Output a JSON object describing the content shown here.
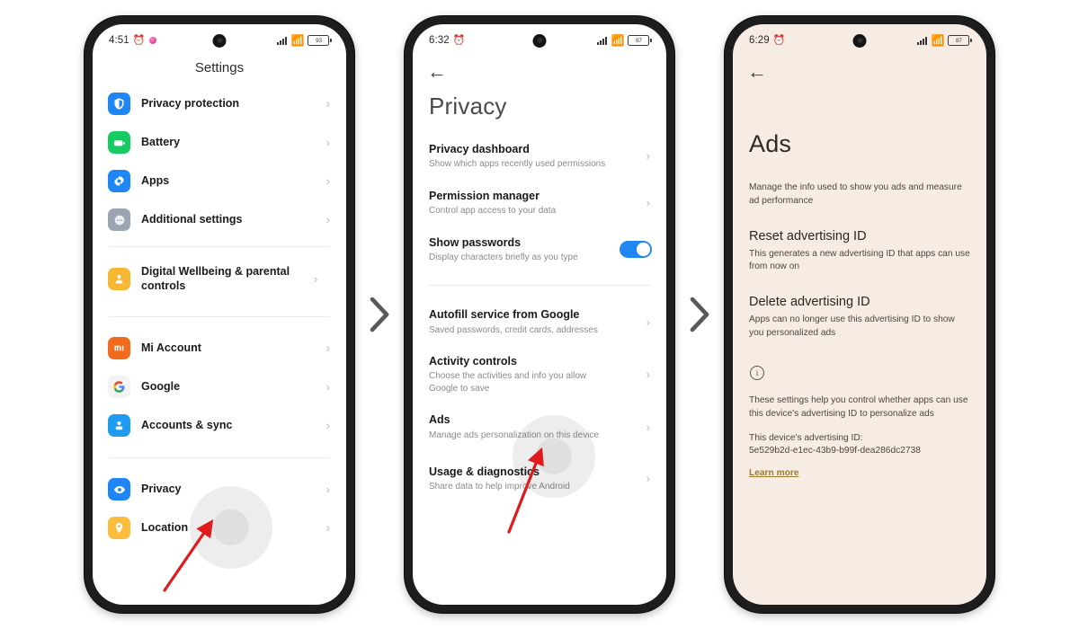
{
  "flow": {
    "separator_icon": "chevron-right-icon",
    "separator_color": "#595959"
  },
  "phone1": {
    "status_bar": {
      "time": "4:51",
      "alarm_icon": "alarm-clock-icon",
      "notification_icon": "notification-dot-icon",
      "signal_icon": "cellular-signal-icon",
      "wifi_icon": "wifi-icon",
      "battery_level": "93"
    },
    "header_title": "Settings",
    "groups": [
      {
        "items": [
          {
            "label": "Privacy protection",
            "icon": "shield-privacy-icon",
            "icon_bg": "#1f86f5",
            "chevron": "›"
          },
          {
            "label": "Battery",
            "icon": "battery-icon",
            "icon_bg": "#16cc62",
            "chevron": "›"
          },
          {
            "label": "Apps",
            "icon": "apps-gear-icon",
            "icon_bg": "#1f86f5",
            "chevron": "›"
          },
          {
            "label": "Additional settings",
            "icon": "more-dots-icon",
            "icon_bg": "#9aa5b1",
            "chevron": "›"
          }
        ]
      },
      {
        "items": [
          {
            "label": "Digital Wellbeing & parental controls",
            "icon": "person-wellbeing-icon",
            "icon_bg": "#f7b733",
            "chevron": "›"
          }
        ]
      },
      {
        "items": [
          {
            "label": "Mi Account",
            "icon": "mi-logo-icon",
            "icon_bg": "#f26a1b",
            "chevron": "›"
          },
          {
            "label": "Google",
            "icon": "google-g-icon",
            "icon_bg": "#f3f3f3",
            "chevron": "›"
          },
          {
            "label": "Accounts & sync",
            "icon": "person-account-icon",
            "icon_bg": "#1f9cf0",
            "chevron": "›"
          }
        ]
      },
      {
        "items": [
          {
            "label": "Privacy",
            "icon": "eye-privacy-icon",
            "icon_bg": "#1f86f5",
            "chevron": "›"
          },
          {
            "label": "Location",
            "icon": "location-pin-icon",
            "icon_bg": "#fbbd3b",
            "chevron": "›"
          }
        ]
      }
    ],
    "tap_target_label": "Privacy",
    "annotation_arrow_color": "#e01b1b"
  },
  "phone2": {
    "status_bar": {
      "time": "6:32",
      "alarm_icon": "alarm-clock-icon",
      "signal_icon": "cellular-signal-icon",
      "wifi_icon": "wifi-icon",
      "battery_level": "87"
    },
    "back_icon": "back-arrow-icon",
    "title": "Privacy",
    "groups": [
      {
        "items": [
          {
            "title": "Privacy dashboard",
            "subtitle": "Show which apps recently used permissions",
            "control": "chevron",
            "chevron": "›"
          },
          {
            "title": "Permission manager",
            "subtitle": "Control app access to your data",
            "control": "chevron",
            "chevron": "›"
          },
          {
            "title": "Show passwords",
            "subtitle": "Display characters briefly as you type",
            "control": "toggle",
            "toggle_on": true
          }
        ]
      },
      {
        "items": [
          {
            "title": "Autofill service from Google",
            "subtitle": "Saved passwords, credit cards, addresses",
            "control": "chevron",
            "chevron": "›"
          },
          {
            "title": "Activity controls",
            "subtitle": "Choose the activities and info you allow Google to save",
            "control": "chevron",
            "chevron": "›"
          },
          {
            "title": "Ads",
            "subtitle": "Manage ads personalization on this device",
            "control": "chevron",
            "chevron": "›"
          },
          {
            "title": "Usage & diagnostics",
            "subtitle": "Share data to help improve Android",
            "control": "chevron",
            "chevron": "›"
          }
        ]
      }
    ],
    "toggle_color": "#1f86f5",
    "tap_target_label": "Ads",
    "annotation_arrow_color": "#e01b1b"
  },
  "phone3": {
    "status_bar": {
      "time": "6:29",
      "alarm_icon": "alarm-clock-icon",
      "signal_icon": "cellular-signal-icon",
      "wifi_icon": "wifi-icon",
      "battery_level": "87"
    },
    "back_icon": "back-arrow-icon",
    "title": "Ads",
    "lead": "Manage the info used to show you ads and measure ad performance",
    "items": [
      {
        "title": "Reset advertising ID",
        "subtitle": "This generates a new advertising ID that apps can use from now on"
      },
      {
        "title": "Delete advertising ID",
        "subtitle": "Apps can no longer use this advertising ID to show you personalized ads"
      }
    ],
    "info_icon": "info-circle-icon",
    "info_text": "These settings help you control whether apps can use this device's advertising ID to personalize ads",
    "device_id_label": "This device's advertising ID:",
    "device_id_value": "5e529b2d-e1ec-43b9-b99f-dea286dc2738",
    "learn_more": "Learn more",
    "learn_more_color": "#9a7a33",
    "background": "#f7ece4"
  }
}
